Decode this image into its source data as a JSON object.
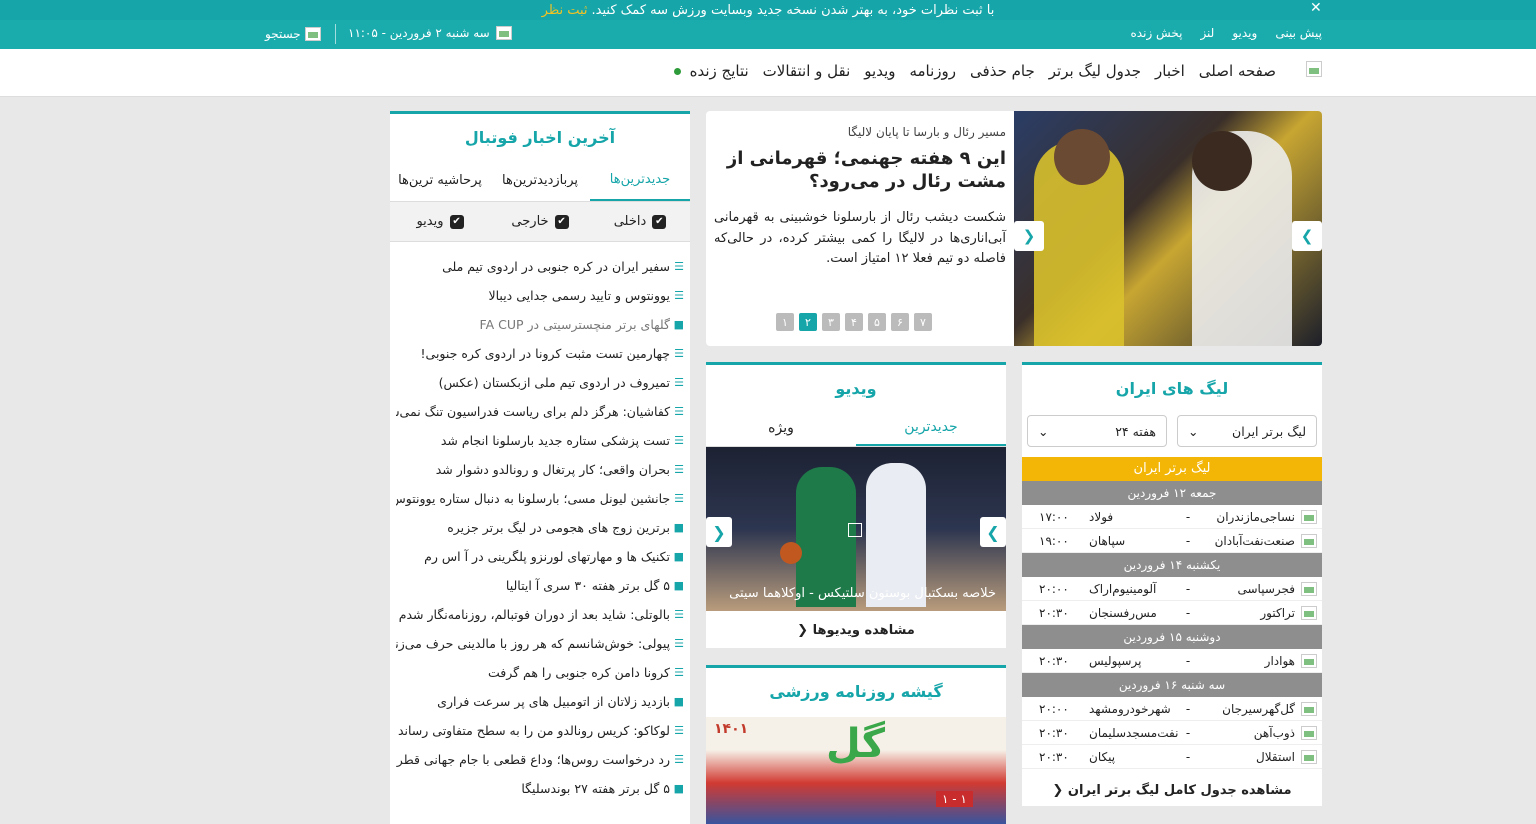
{
  "notice": {
    "text": "با ثبت نظرات خود، به بهتر شدن نسخه جدید وبسایت ورزش سه کمک کنید.",
    "cta": "ثبت نظر",
    "close": "✕"
  },
  "topbar": {
    "links": [
      "پیش بینی",
      "ویدیو",
      "لنز",
      "پخش زنده"
    ],
    "date": "سه شنبه ۲ فروردین - ۱۱:۰۵",
    "search": "جستجو"
  },
  "nav": {
    "items": [
      "صفحه اصلی",
      "اخبار",
      "جدول لیگ برتر",
      "جام حذفی",
      "روزنامه",
      "ویدیو",
      "نقل و انتقالات",
      "نتایج زنده"
    ]
  },
  "slider": {
    "kicker": "مسیر رئال و بارسا تا پایان لالیگا",
    "title": "این ۹ هفته جهنمی؛ قهرمانی از مشت رئال در می‌رود؟",
    "lead": "شکست دیشب رئال از بارسلونا خوشبینی به قهرمانی آبی‌اناری‌ها در لالیگا را کمی بیشتر کرده، در حالی‌که فاصله دو تیم فعلا ۱۲ امتیاز است.",
    "pages": [
      "۱",
      "۲",
      "۳",
      "۴",
      "۵",
      "۶",
      "۷"
    ],
    "active_page": 1
  },
  "news": {
    "title": "آخرین اخبار فوتبال",
    "tabs": [
      "جدیدترین‌ها",
      "پربازدیدترین‌ها",
      "پرحاشیه ترین‌ها"
    ],
    "filters": [
      "داخلی",
      "خارجی",
      "ویدیو"
    ],
    "items": [
      {
        "text": "سفیر ایران در کره جنوبی در اردوی تیم ملی",
        "type": "text"
      },
      {
        "text": "یوونتوس و تایید رسمی جدایی دیبالا",
        "type": "text"
      },
      {
        "text": "گلهای برتر منچسترسیتی در FA CUP",
        "type": "video"
      },
      {
        "text": "چهارمین تست مثبت کرونا در اردوی کره جنوبی!",
        "type": "text"
      },
      {
        "text": "تمیروف در اردوی تیم ملی ازبکستان (عکس)",
        "type": "text"
      },
      {
        "text": "کفاشیان: هرگز دلم برای ریاست فدراسیون تنگ نمی‌شود",
        "type": "text"
      },
      {
        "text": "تست پزشکی ستاره جدید بارسلونا انجام شد",
        "type": "text"
      },
      {
        "text": "بحران واقعی؛ کار پرتغال و رونالدو دشوار شد",
        "type": "text"
      },
      {
        "text": "جانشین لیونل مسی؛ بارسلونا به دنبال ستاره یوونتوس",
        "type": "text"
      },
      {
        "text": "برترین زوج های هجومی در لیگ برتر جزیره",
        "type": "video2"
      },
      {
        "text": "تکنیک ها و مهارتهای لورنزو پلگرینی در آ اس رم",
        "type": "video2"
      },
      {
        "text": "۵ گل برتر هفته ۳۰ سری آ ایتالیا",
        "type": "video2"
      },
      {
        "text": "بالوتلی: شاید بعد از دوران فوتبالم، روزنامه‌نگار شدم",
        "type": "text"
      },
      {
        "text": "پیولی: خوش‌شانسم که هر روز با مالدینی حرف می‌زنم",
        "type": "text"
      },
      {
        "text": "کرونا دامن کره جنوبی را هم گرفت",
        "type": "text"
      },
      {
        "text": "بازدید زلاتان از اتومبیل های پر سرعت فراری",
        "type": "video2"
      },
      {
        "text": "لوکاکو: کریس رونالدو من را به سطح متفاوتی رساند",
        "type": "text"
      },
      {
        "text": "رد درخواست روس‌ها؛ وداع قطعی با جام جهانی قطر",
        "type": "text"
      },
      {
        "text": "۵ گل برتر هفته ۲۷ بوندسلیگا",
        "type": "video2"
      }
    ]
  },
  "leagues": {
    "title": "لیگ های ایران",
    "league_select": "لیگ برتر ایران",
    "week_select": "هفته ۲۴",
    "header": "لیگ برتر ایران",
    "days": [
      {
        "label": "جمعه ۱۲ فروردین",
        "matches": [
          {
            "home": "نساجی‌مازندران",
            "away": "فولاد",
            "time": "۱۷:۰۰"
          },
          {
            "home": "صنعت‌نفت‌آبادان",
            "away": "سپاهان",
            "time": "۱۹:۰۰"
          }
        ]
      },
      {
        "label": "یکشنبه ۱۴ فروردین",
        "matches": [
          {
            "home": "فجرسپاسی",
            "away": "آلومینیوم‌اراک",
            "time": "۲۰:۰۰"
          },
          {
            "home": "تراکتور",
            "away": "مس‌رفسنجان",
            "time": "۲۰:۳۰"
          }
        ]
      },
      {
        "label": "دوشنبه ۱۵ فروردین",
        "matches": [
          {
            "home": "هوادار",
            "away": "پرسپولیس",
            "time": "۲۰:۳۰"
          }
        ]
      },
      {
        "label": "سه شنبه ۱۶ فروردین",
        "matches": [
          {
            "home": "گل‌گهرسیرجان",
            "away": "شهرخودرومشهد",
            "time": "۲۰:۰۰"
          },
          {
            "home": "ذوب‌آهن",
            "away": "نفت‌مسجدسلیمان",
            "time": "۲۰:۳۰"
          },
          {
            "home": "استقلال",
            "away": "پیکان",
            "time": "۲۰:۳۰"
          }
        ]
      }
    ],
    "more": "مشاهده جدول کامل لیگ برتر ایران"
  },
  "videos": {
    "title": "ویدیو",
    "tabs": [
      "جدیدترین",
      "ویژه"
    ],
    "caption": "خلاصه بسکتبال بوستون سلتیکس - اوکلاهما سیتی",
    "more": "مشاهده ویدیوها"
  },
  "papers": {
    "title": "گیشه روزنامه ورزشی",
    "cover_year": "۱۴۰۱",
    "cover_logo": "گل",
    "cover_score": "۱ - ۱"
  }
}
